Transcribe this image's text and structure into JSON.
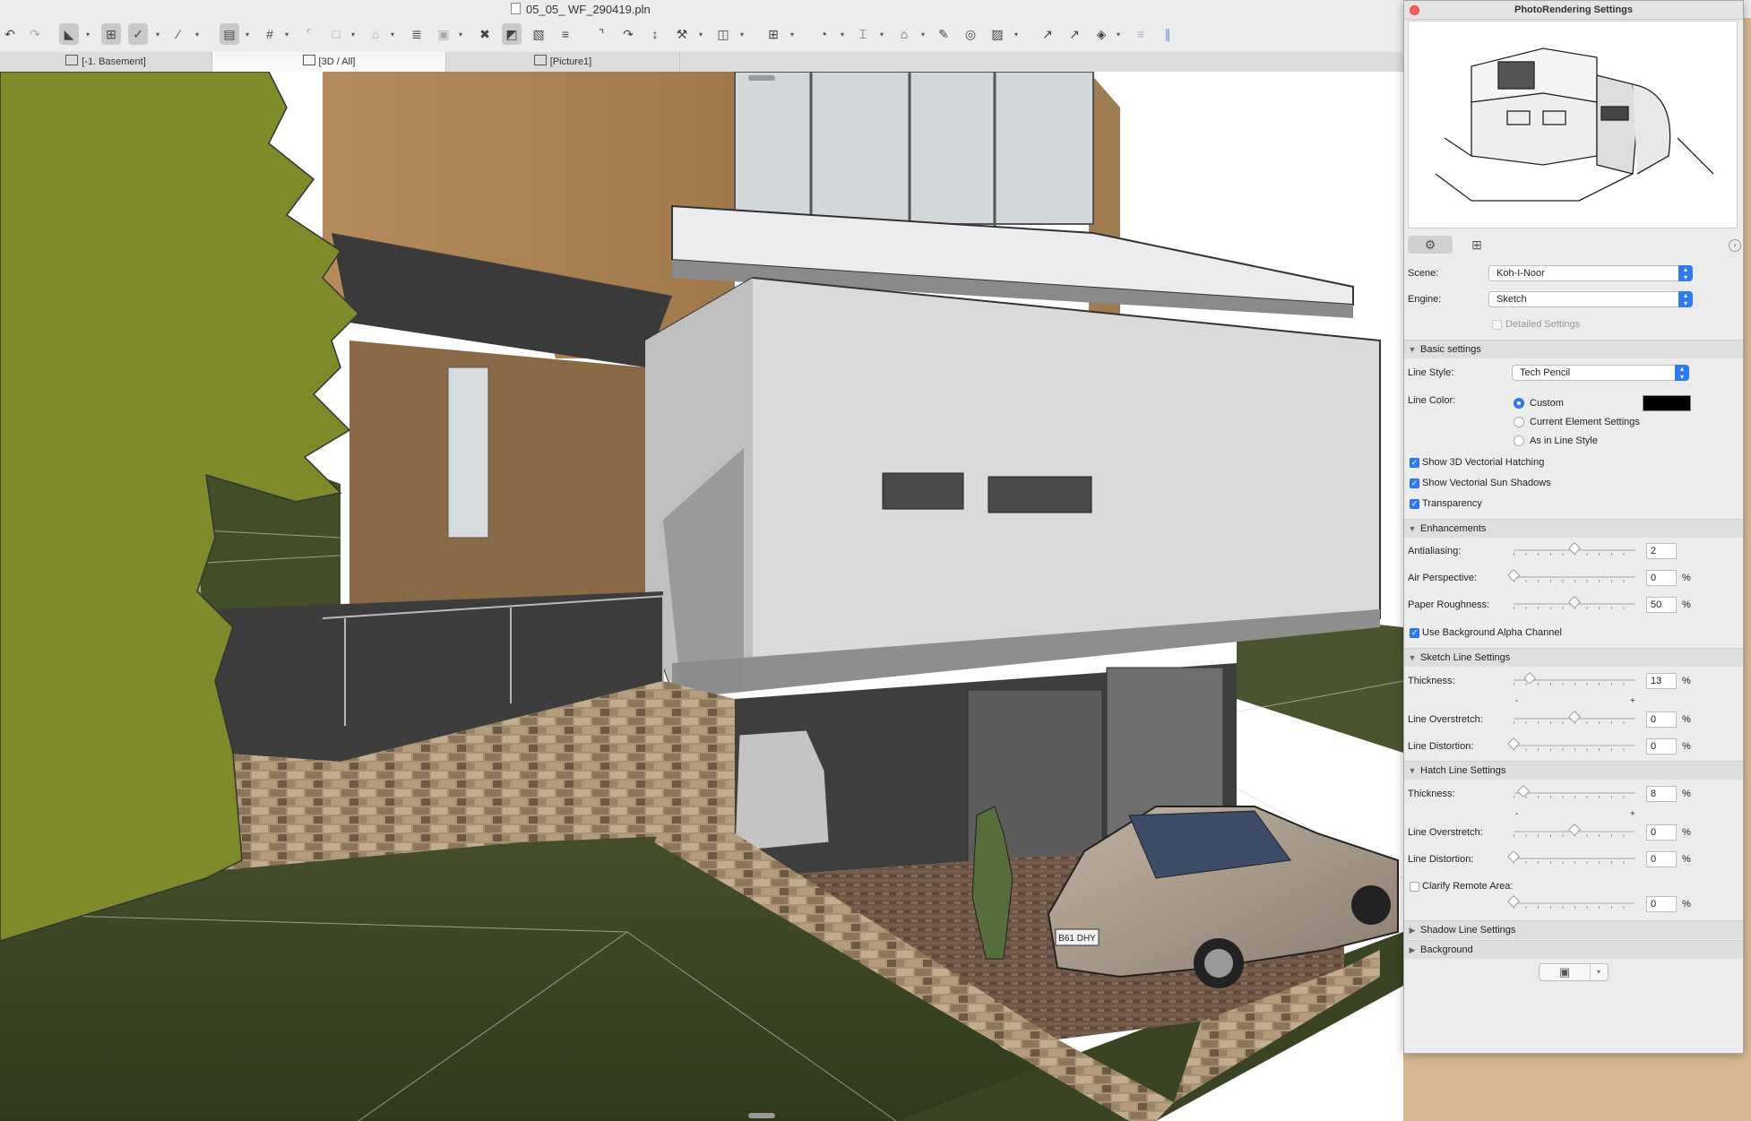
{
  "window": {
    "title": "05_05_ WF_290419.pln"
  },
  "tabs": [
    {
      "label": "[-1. Basement]"
    },
    {
      "label": "[3D / All]"
    },
    {
      "label": "[Picture1]"
    }
  ],
  "toolbar": {
    "icons": [
      "undo-icon",
      "redo-icon",
      "arrow-tool-icon",
      "marquee-icon",
      "snap-guides-icon",
      "line-tool-icon",
      "grid-snap-icon",
      "layers-icon",
      "trace-icon",
      "lock-icon",
      "dimension-icon",
      "elevation-icon",
      "move-icon",
      "render-icon",
      "stairs-icon",
      "section-icon",
      "rotate-icon",
      "mirror-icon",
      "eyedropper-icon",
      "globe-icon",
      "text-icon",
      "house-icon",
      "pen-icon",
      "fill-icon",
      "view-icon",
      "pipette-icon",
      "syringe-icon",
      "paint-icon",
      "zone-icon",
      "pencil-icon"
    ]
  },
  "panel": {
    "title": "PhotoRendering Settings",
    "scene_label": "Scene:",
    "scene_value": "Koh-I-Noor",
    "engine_label": "Engine:",
    "engine_value": "Sketch",
    "detailed_settings": "Detailed Settings",
    "basic_section": "Basic settings",
    "line_style_label": "Line Style:",
    "line_style_value": "Tech Pencil",
    "line_color_label": "Line Color:",
    "line_color_options": [
      "Custom",
      "Current Element Settings",
      "As in Line Style"
    ],
    "line_color_selected": "Custom",
    "line_color_swatch": "#000000",
    "show_hatching": "Show 3D Vectorial Hatching",
    "show_shadows": "Show Vectorial Sun Shadows",
    "transparency": "Transparency",
    "enhancements_section": "Enhancements",
    "antialiasing_label": "Antialiasing:",
    "antialiasing_value": "2",
    "antialiasing_level": 0.5,
    "air_perspective_label": "Air Perspective:",
    "air_perspective_value": "0",
    "paper_roughness_label": "Paper Roughness:",
    "paper_roughness_value": "50",
    "use_alpha": "Use Background Alpha Channel",
    "sketch_section": "Sketch Line Settings",
    "sketch_thickness_label": "Thickness:",
    "sketch_thickness_value": "13",
    "sketch_overstretch_label": "Line Overstretch:",
    "sketch_overstretch_value": "0",
    "sketch_distortion_label": "Line Distortion:",
    "sketch_distortion_value": "0",
    "hatch_section": "Hatch Line Settings",
    "hatch_thickness_label": "Thickness:",
    "hatch_thickness_value": "8",
    "hatch_overstretch_label": "Line Overstretch:",
    "hatch_overstretch_value": "0",
    "hatch_distortion_label": "Line Distortion:",
    "hatch_distortion_value": "0",
    "clarify_label": "Clarify Remote Area:",
    "clarify_value": "0",
    "shadow_section": "Shadow Line Settings",
    "background_section": "Background",
    "percent": "%",
    "minus": "-",
    "plus": "+"
  },
  "viewport": {
    "license_plate": "B61 DHY",
    "sky_color": "#ffffff",
    "grass_color": "#3f4a24",
    "tree_color": "#7f8a2a",
    "wall_color": "#d9d9d9",
    "wood_color": "#b28a5c"
  }
}
